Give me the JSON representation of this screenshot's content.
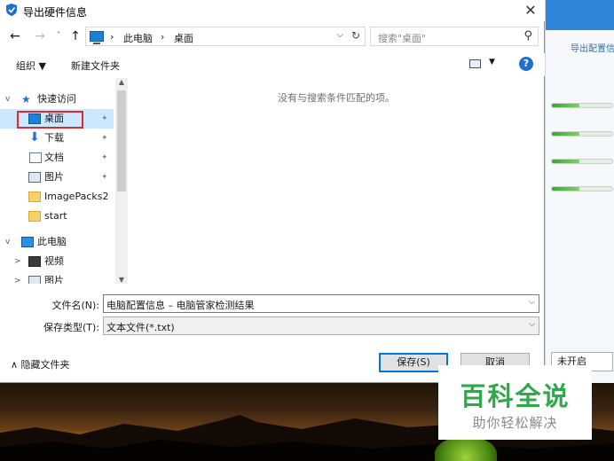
{
  "dialog": {
    "title": "导出硬件信息",
    "close_glyph": "✕"
  },
  "nav": {
    "back": "←",
    "forward": "→",
    "history": "˅",
    "up": "↑",
    "breadcrumbs": [
      "此电脑",
      "桌面"
    ],
    "separator": "›",
    "search_placeholder": "搜索\"桌面\""
  },
  "toolbar": {
    "organize": "组织 ▼",
    "new_folder": "新建文件夹",
    "help": "?"
  },
  "sidebar": {
    "items": [
      {
        "label": "快速访问",
        "icon": "star-icon",
        "expander": "v",
        "level": 0
      },
      {
        "label": "桌面",
        "icon": "desktop-icon",
        "pinned": true,
        "selected": true,
        "level": 1
      },
      {
        "label": "下载",
        "icon": "download-icon",
        "pinned": true,
        "level": 1
      },
      {
        "label": "文档",
        "icon": "document-icon",
        "pinned": true,
        "level": 1
      },
      {
        "label": "图片",
        "icon": "pictures-icon",
        "pinned": true,
        "level": 1
      },
      {
        "label": "ImagePacks2",
        "icon": "folder-icon",
        "level": 1
      },
      {
        "label": "start",
        "icon": "folder-icon",
        "level": 1
      },
      {
        "label": "此电脑",
        "icon": "pc-icon",
        "expander": "v",
        "level": 0
      },
      {
        "label": "视频",
        "icon": "video-icon",
        "expander": ">",
        "level": 1
      },
      {
        "label": "图片",
        "icon": "pictures-icon",
        "expander": ">",
        "level": 1
      }
    ]
  },
  "content": {
    "empty_message": "没有与搜索条件匹配的项。"
  },
  "form": {
    "filename_label": "文件名(N):",
    "filename_value": "电脑配置信息 – 电脑管家检测结果",
    "filetype_label": "保存类型(T):",
    "filetype_value": "文本文件(*.txt)"
  },
  "footer": {
    "hide_folders": "∧  隐藏文件夹",
    "save": "保存(S)",
    "cancel": "取消"
  },
  "background_app": {
    "title": "导出配置信",
    "button": "未开启"
  },
  "watermark": {
    "brand": "百科全说",
    "slogan": "助你轻松解决"
  },
  "colors": {
    "accent": "#0078d7",
    "selection": "#cce8ff",
    "highlight_box": "#e0282e",
    "watermark_green": "#2fa84a"
  }
}
